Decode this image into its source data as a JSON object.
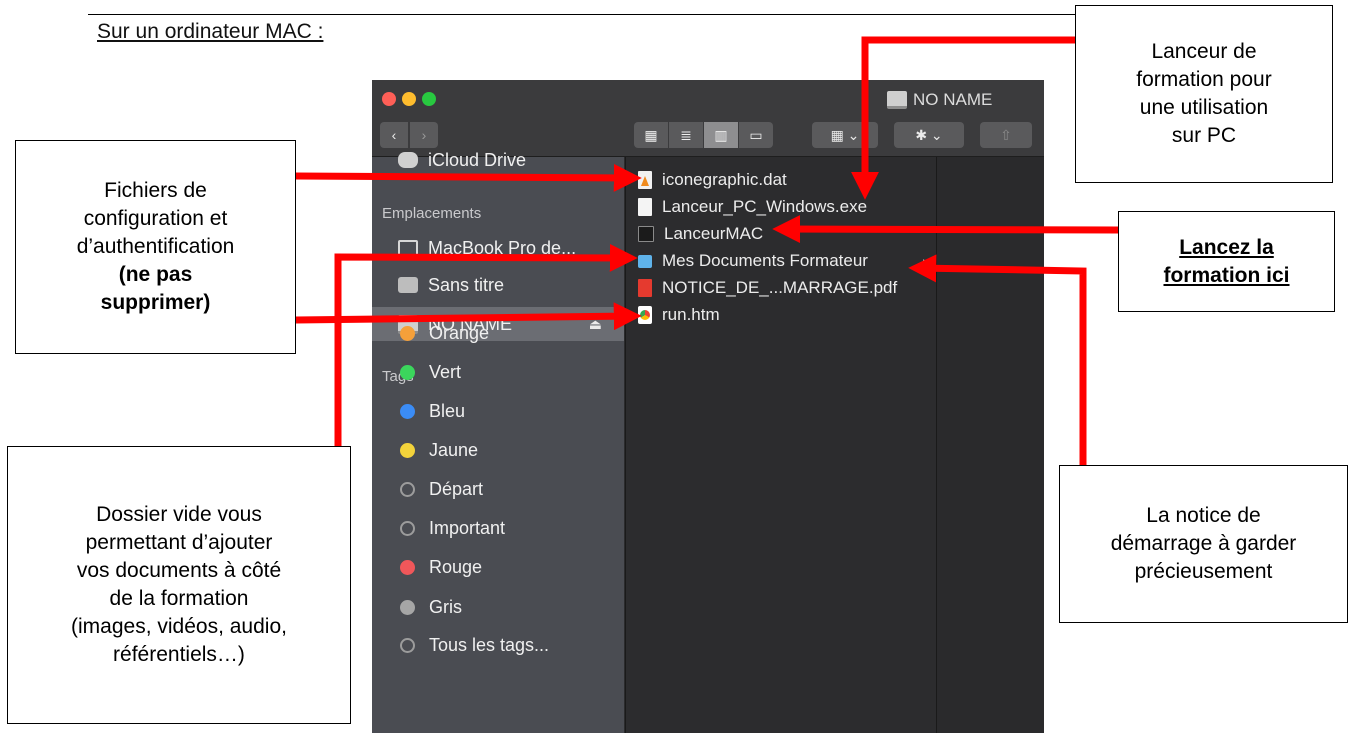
{
  "heading": "Sur un ordinateur MAC :",
  "finder": {
    "window_title": "NO NAME",
    "toolbar": {
      "back": "‹",
      "forward": "›",
      "view_icons": [
        "▦",
        "≣",
        "▥",
        "▭"
      ],
      "arrange": "▦ ⌄",
      "action": "✱ ⌄",
      "share": "⇧"
    },
    "sidebar": {
      "cut_item": "iCloud Drive",
      "section_locations": "Emplacements",
      "locations": [
        "MacBook Pro de...",
        "Sans titre",
        "NO NAME"
      ],
      "eject": "⏏",
      "section_tags": "Tags",
      "tags": [
        {
          "label": "Orange",
          "color": "#f5a03a"
        },
        {
          "label": "Vert",
          "color": "#3bd65c"
        },
        {
          "label": "Bleu",
          "color": "#3b8cf5"
        },
        {
          "label": "Jaune",
          "color": "#f3d33b"
        },
        {
          "label": "Départ",
          "color": "hollow"
        },
        {
          "label": "Important",
          "color": "hollow"
        },
        {
          "label": "Rouge",
          "color": "#f0575a"
        },
        {
          "label": "Gris",
          "color": "#a6a6a6"
        },
        {
          "label": "Tous les tags...",
          "color": "hollow"
        }
      ]
    },
    "files": [
      {
        "name": "iconegraphic.dat",
        "icon": "vlc-doc-icon"
      },
      {
        "name": "Lanceur_PC_Windows.exe",
        "icon": "document-icon"
      },
      {
        "name": "LanceurMAC",
        "icon": "terminal-icon"
      },
      {
        "name": "Mes Documents Formateur",
        "icon": "folder-icon"
      },
      {
        "name": "NOTICE_DE_...MARRAGE.pdf",
        "icon": "pdf-icon"
      },
      {
        "name": "run.htm",
        "icon": "chrome-doc-icon"
      }
    ],
    "folder_chevron": "▶"
  },
  "callouts": {
    "config": {
      "lines": [
        "Fichiers de",
        "configuration et",
        "d’authentification"
      ],
      "bold": [
        "(ne pas",
        "supprimer)"
      ]
    },
    "launcher_pc": [
      "Lanceur de",
      "formation pour",
      "une utilisation",
      "sur PC"
    ],
    "launch_here": [
      "Lancez la",
      "formation ici"
    ],
    "empty_folder": [
      "Dossier vide vous",
      "permettant d’ajouter",
      "vos documents à côté",
      "de la formation",
      "(images, vidéos, audio,",
      "référentiels…)"
    ],
    "notice": [
      "La notice de",
      "démarrage à garder",
      "précieusement"
    ]
  },
  "colors": {
    "arrow": "#ff0000",
    "sidebar": "#4a4c52",
    "window": "#2b2b2d"
  }
}
